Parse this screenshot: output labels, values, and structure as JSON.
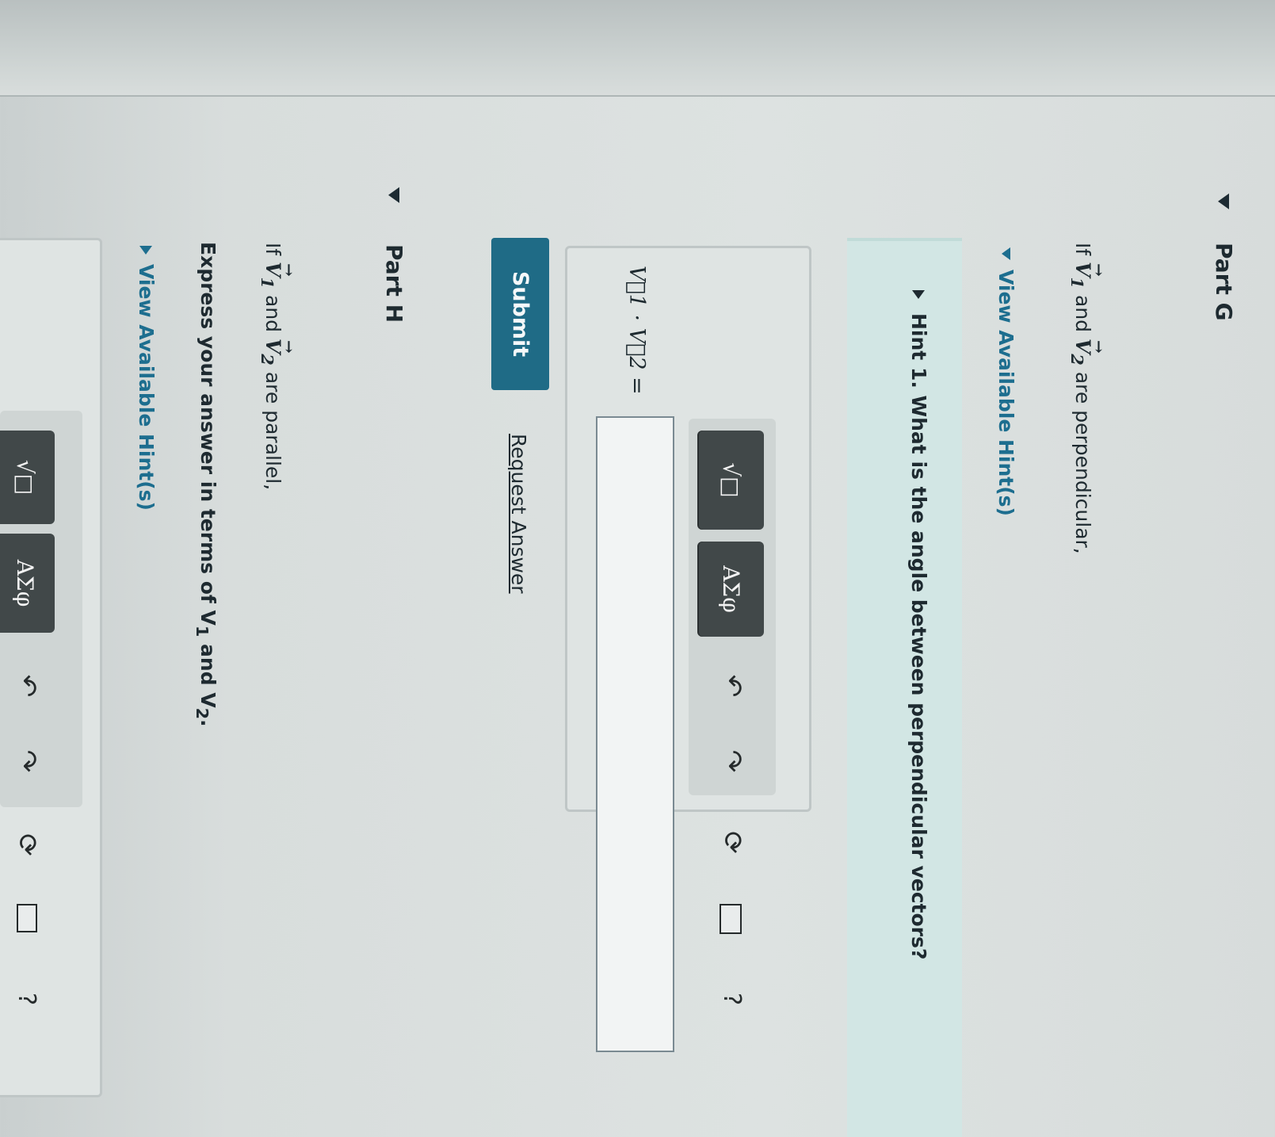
{
  "part_g": {
    "title": "Part G",
    "statement_if": "If",
    "v1": "V",
    "v1_sub": "1",
    "and": "and",
    "v2": "V",
    "v2_sub": "2",
    "tail": "are perpendicular,",
    "hints_label": "View Available Hint(s)",
    "hint1": "Hint 1. What is the angle between perpendicular vectors?",
    "toolbar": {
      "templates_label": "√□",
      "greek_label": "ΑΣφ",
      "help_label": "?"
    },
    "answer_label": "V⃗1 · V⃗2 =",
    "input_value": "",
    "submit_label": "Submit",
    "request_answer_label": "Request Answer"
  },
  "part_h": {
    "title": "Part H",
    "statement_if": "If",
    "v1": "V",
    "v1_sub": "1",
    "and": "and",
    "v2": "V",
    "v2_sub": "2",
    "tail": "are parallel,",
    "express_text": "Express your answer in terms of V",
    "express_sub1": "1",
    "express_and": "and V",
    "express_sub2": "2",
    "express_end": ".",
    "hints_label": "View Available Hint(s)",
    "toolbar": {
      "templates_label": "√□",
      "greek_label": "ΑΣφ",
      "help_label": "?"
    }
  },
  "icons": {
    "undo": "undo-icon",
    "redo": "redo-icon",
    "reset": "reset-icon",
    "keyboard": "keyboard-icon"
  }
}
